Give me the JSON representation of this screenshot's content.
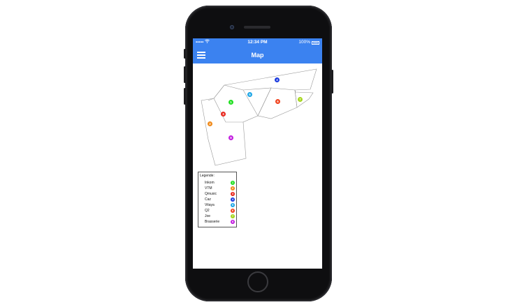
{
  "status_bar": {
    "signal": "•••••",
    "wifi_icon": "wifi-icon",
    "time": "12:34 PM",
    "battery": "100%",
    "battery_level": 1.0
  },
  "nav": {
    "title": "Map",
    "menu_icon": "hamburger-menu-icon"
  },
  "markers": [
    {
      "number": "1",
      "color": "#22e022"
    },
    {
      "number": "2",
      "color": "#f08a1a"
    },
    {
      "number": "3",
      "color": "#e8281e"
    },
    {
      "number": "4",
      "color": "#1a3adf"
    },
    {
      "number": "5",
      "color": "#1ea6e6"
    },
    {
      "number": "6",
      "color": "#f0421e"
    },
    {
      "number": "7",
      "color": "#a6d61e"
    },
    {
      "number": "8",
      "color": "#c21edf"
    }
  ],
  "legend": {
    "title": "Legende:",
    "items": [
      {
        "label": "Inkom",
        "number": "1",
        "color": "#22e022"
      },
      {
        "label": "VTM",
        "number": "2",
        "color": "#f08a1a"
      },
      {
        "label": "Qmusic",
        "number": "3",
        "color": "#e8281e"
      },
      {
        "label": "Caz",
        "number": "4",
        "color": "#1a3adf"
      },
      {
        "label": "Vitaya",
        "number": "5",
        "color": "#1ea6e6"
      },
      {
        "label": "Q2",
        "number": "6",
        "color": "#f0421e"
      },
      {
        "label": "Joe",
        "number": "7",
        "color": "#a6d61e"
      },
      {
        "label": "Brasserie",
        "number": "8",
        "color": "#c21edf"
      }
    ]
  }
}
